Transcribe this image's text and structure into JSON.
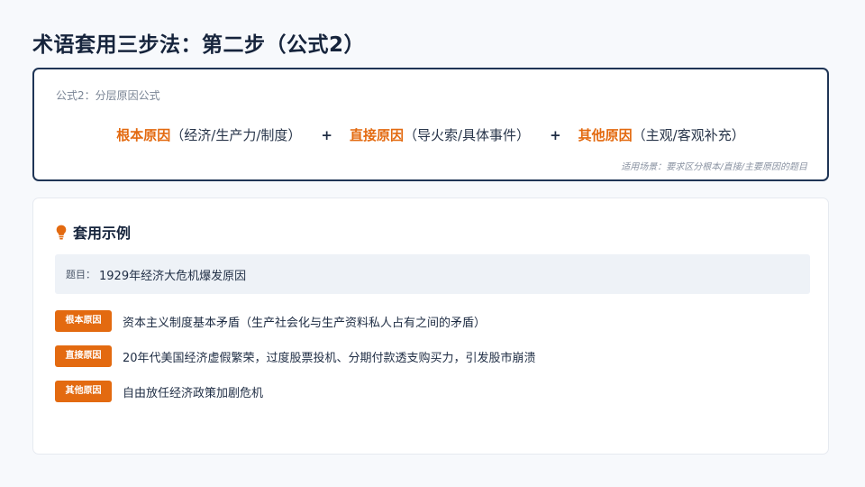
{
  "page": {
    "title": "术语套用三步法：第二步（公式2）"
  },
  "formula": {
    "name": "公式2：分层原因公式",
    "terms": [
      {
        "key": "根本原因",
        "desc": "（经济/生产力/制度）"
      },
      {
        "key": "直接原因",
        "desc": "（导火索/具体事件）"
      },
      {
        "key": "其他原因",
        "desc": "（主观/客观补充）"
      }
    ],
    "operator": "+",
    "scenario": "适用场景：要求区分根本/直接/主要原因的题目"
  },
  "example": {
    "icon": "lightbulb-icon",
    "title": "套用示例",
    "question_label": "题目：",
    "question_text": "1929年经济大危机爆发原因",
    "rows": [
      {
        "tag": "根本原因",
        "text": "资本主义制度基本矛盾（生产社会化与生产资料私人占有之间的矛盾）"
      },
      {
        "tag": "直接原因",
        "text": "20年代美国经济虚假繁荣，过度股票投机、分期付款透支购买力，引发股市崩溃"
      },
      {
        "tag": "其他原因",
        "text": "自由放任经济政策加剧危机"
      }
    ]
  },
  "colors": {
    "accent": "#e36a10",
    "navy": "#1f3556",
    "question_bg": "#eef2f7",
    "page_bg": "#f7f9fc"
  }
}
